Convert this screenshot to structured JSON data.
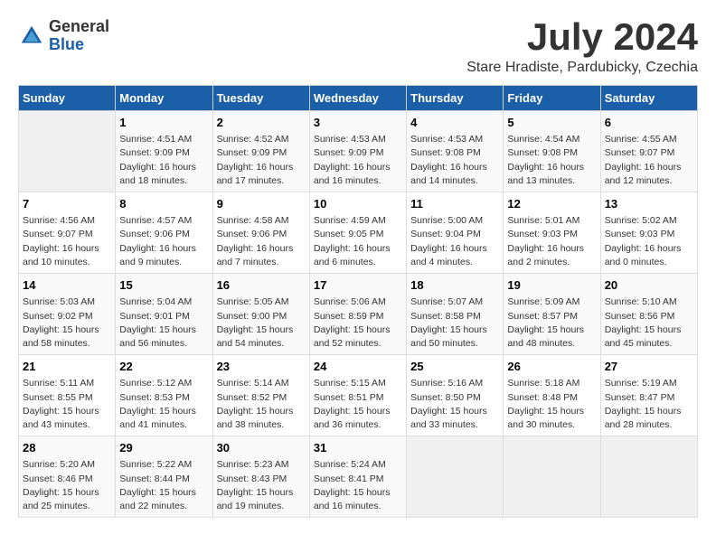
{
  "logo": {
    "general": "General",
    "blue": "Blue"
  },
  "title": "July 2024",
  "location": "Stare Hradiste, Pardubicky, Czechia",
  "headers": [
    "Sunday",
    "Monday",
    "Tuesday",
    "Wednesday",
    "Thursday",
    "Friday",
    "Saturday"
  ],
  "weeks": [
    [
      {
        "day": "",
        "info": ""
      },
      {
        "day": "1",
        "info": "Sunrise: 4:51 AM\nSunset: 9:09 PM\nDaylight: 16 hours\nand 18 minutes."
      },
      {
        "day": "2",
        "info": "Sunrise: 4:52 AM\nSunset: 9:09 PM\nDaylight: 16 hours\nand 17 minutes."
      },
      {
        "day": "3",
        "info": "Sunrise: 4:53 AM\nSunset: 9:09 PM\nDaylight: 16 hours\nand 16 minutes."
      },
      {
        "day": "4",
        "info": "Sunrise: 4:53 AM\nSunset: 9:08 PM\nDaylight: 16 hours\nand 14 minutes."
      },
      {
        "day": "5",
        "info": "Sunrise: 4:54 AM\nSunset: 9:08 PM\nDaylight: 16 hours\nand 13 minutes."
      },
      {
        "day": "6",
        "info": "Sunrise: 4:55 AM\nSunset: 9:07 PM\nDaylight: 16 hours\nand 12 minutes."
      }
    ],
    [
      {
        "day": "7",
        "info": "Sunrise: 4:56 AM\nSunset: 9:07 PM\nDaylight: 16 hours\nand 10 minutes."
      },
      {
        "day": "8",
        "info": "Sunrise: 4:57 AM\nSunset: 9:06 PM\nDaylight: 16 hours\nand 9 minutes."
      },
      {
        "day": "9",
        "info": "Sunrise: 4:58 AM\nSunset: 9:06 PM\nDaylight: 16 hours\nand 7 minutes."
      },
      {
        "day": "10",
        "info": "Sunrise: 4:59 AM\nSunset: 9:05 PM\nDaylight: 16 hours\nand 6 minutes."
      },
      {
        "day": "11",
        "info": "Sunrise: 5:00 AM\nSunset: 9:04 PM\nDaylight: 16 hours\nand 4 minutes."
      },
      {
        "day": "12",
        "info": "Sunrise: 5:01 AM\nSunset: 9:03 PM\nDaylight: 16 hours\nand 2 minutes."
      },
      {
        "day": "13",
        "info": "Sunrise: 5:02 AM\nSunset: 9:03 PM\nDaylight: 16 hours\nand 0 minutes."
      }
    ],
    [
      {
        "day": "14",
        "info": "Sunrise: 5:03 AM\nSunset: 9:02 PM\nDaylight: 15 hours\nand 58 minutes."
      },
      {
        "day": "15",
        "info": "Sunrise: 5:04 AM\nSunset: 9:01 PM\nDaylight: 15 hours\nand 56 minutes."
      },
      {
        "day": "16",
        "info": "Sunrise: 5:05 AM\nSunset: 9:00 PM\nDaylight: 15 hours\nand 54 minutes."
      },
      {
        "day": "17",
        "info": "Sunrise: 5:06 AM\nSunset: 8:59 PM\nDaylight: 15 hours\nand 52 minutes."
      },
      {
        "day": "18",
        "info": "Sunrise: 5:07 AM\nSunset: 8:58 PM\nDaylight: 15 hours\nand 50 minutes."
      },
      {
        "day": "19",
        "info": "Sunrise: 5:09 AM\nSunset: 8:57 PM\nDaylight: 15 hours\nand 48 minutes."
      },
      {
        "day": "20",
        "info": "Sunrise: 5:10 AM\nSunset: 8:56 PM\nDaylight: 15 hours\nand 45 minutes."
      }
    ],
    [
      {
        "day": "21",
        "info": "Sunrise: 5:11 AM\nSunset: 8:55 PM\nDaylight: 15 hours\nand 43 minutes."
      },
      {
        "day": "22",
        "info": "Sunrise: 5:12 AM\nSunset: 8:53 PM\nDaylight: 15 hours\nand 41 minutes."
      },
      {
        "day": "23",
        "info": "Sunrise: 5:14 AM\nSunset: 8:52 PM\nDaylight: 15 hours\nand 38 minutes."
      },
      {
        "day": "24",
        "info": "Sunrise: 5:15 AM\nSunset: 8:51 PM\nDaylight: 15 hours\nand 36 minutes."
      },
      {
        "day": "25",
        "info": "Sunrise: 5:16 AM\nSunset: 8:50 PM\nDaylight: 15 hours\nand 33 minutes."
      },
      {
        "day": "26",
        "info": "Sunrise: 5:18 AM\nSunset: 8:48 PM\nDaylight: 15 hours\nand 30 minutes."
      },
      {
        "day": "27",
        "info": "Sunrise: 5:19 AM\nSunset: 8:47 PM\nDaylight: 15 hours\nand 28 minutes."
      }
    ],
    [
      {
        "day": "28",
        "info": "Sunrise: 5:20 AM\nSunset: 8:46 PM\nDaylight: 15 hours\nand 25 minutes."
      },
      {
        "day": "29",
        "info": "Sunrise: 5:22 AM\nSunset: 8:44 PM\nDaylight: 15 hours\nand 22 minutes."
      },
      {
        "day": "30",
        "info": "Sunrise: 5:23 AM\nSunset: 8:43 PM\nDaylight: 15 hours\nand 19 minutes."
      },
      {
        "day": "31",
        "info": "Sunrise: 5:24 AM\nSunset: 8:41 PM\nDaylight: 15 hours\nand 16 minutes."
      },
      {
        "day": "",
        "info": ""
      },
      {
        "day": "",
        "info": ""
      },
      {
        "day": "",
        "info": ""
      }
    ]
  ]
}
